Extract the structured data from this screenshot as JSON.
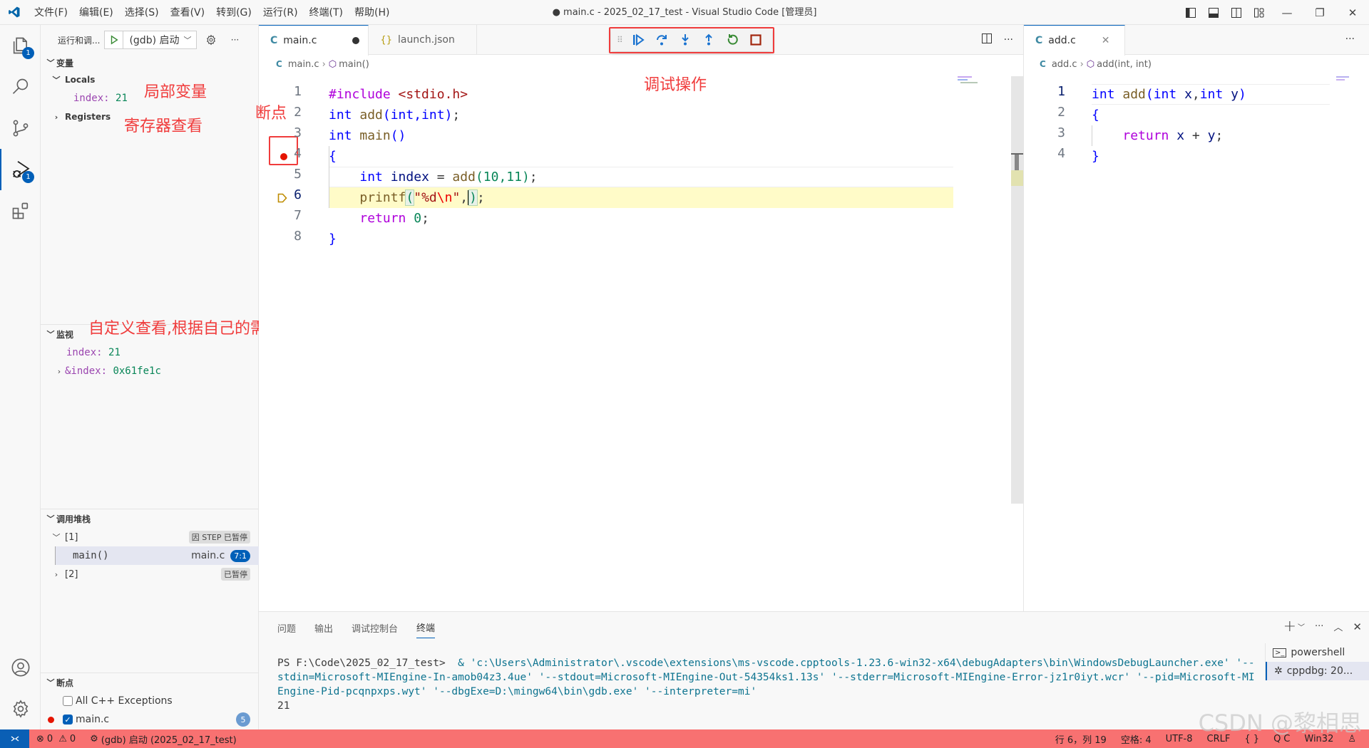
{
  "titlebar": {
    "menus": [
      "文件(F)",
      "编辑(E)",
      "选择(S)",
      "查看(V)",
      "转到(G)",
      "运行(R)",
      "终端(T)",
      "帮助(H)"
    ],
    "window_title": "● main.c - 2025_02_17_test - Visual Studio Code [管理员]",
    "minimize": "—",
    "restore": "❐",
    "close": "✕"
  },
  "activitybar": {
    "explorer_badge": "1",
    "debug_badge": "1"
  },
  "sidebar": {
    "title": "运行和调...",
    "launch_config": "(gdb) 启动",
    "variables": {
      "header": "变量",
      "locals_label": "Locals",
      "locals": [
        {
          "name": "index",
          "value": "21"
        }
      ],
      "registers_label": "Registers"
    },
    "watch": {
      "header": "监视",
      "items": [
        {
          "name": "index",
          "value": "21",
          "expandable": false
        },
        {
          "name": "&index",
          "value": "0x61fe1c",
          "expandable": true
        }
      ]
    },
    "callstack": {
      "header": "调用堆栈",
      "threads": [
        {
          "label": "[1]",
          "status": "因 STEP 已暂停",
          "expanded": true
        },
        {
          "label": "[2]",
          "status": "已暂停",
          "expanded": false
        }
      ],
      "frame": {
        "name": "main()",
        "file": "main.c",
        "pos": "7:1"
      }
    },
    "breakpoints": {
      "header": "断点",
      "items": [
        {
          "label": "All C++ Exceptions",
          "checked": false
        },
        {
          "label": "main.c",
          "checked": true,
          "line": "5"
        }
      ]
    }
  },
  "annotations": {
    "locals": "局部变量",
    "registers": "寄存器查看",
    "breakpoint": "断点",
    "debug_ops": "调试操作",
    "watch": "自定义查看,根据自己的需求查看"
  },
  "editor_main": {
    "tabs": [
      {
        "label": "main.c",
        "icon": "C",
        "active": true,
        "dirty": true
      },
      {
        "label": "launch.json",
        "icon": "{}",
        "active": false
      }
    ],
    "breadcrumb": [
      "main.c",
      "main()"
    ],
    "lines": [
      "1",
      "2",
      "3",
      "4",
      "5",
      "6",
      "7",
      "8"
    ],
    "breakpoint_line": 5,
    "current_line": 7,
    "cursor_line": 6
  },
  "editor_right": {
    "tabs": [
      {
        "label": "add.c",
        "icon": "C",
        "active": true
      }
    ],
    "breadcrumb": [
      "add.c",
      "add(int, int)"
    ],
    "lines": [
      "1",
      "2",
      "3",
      "4"
    ]
  },
  "panel": {
    "tabs": [
      "问题",
      "输出",
      "调试控制台",
      "终端"
    ],
    "active_tab": "终端",
    "terminal": {
      "prompt": "PS F:\\Code\\2025_02_17_test> ",
      "command": " & 'c:\\Users\\Administrator\\.vscode\\extensions\\ms-vscode.cpptools-1.23.6-win32-x64\\debugAdapters\\bin\\WindowsDebugLauncher.exe' '--stdin=Microsoft-MIEngine-In-amob04z3.4ue' '--stdout=Microsoft-MIEngine-Out-54354ks1.13s' '--stderr=Microsoft-MIEngine-Error-jz1r0iyt.wcr' '--pid=Microsoft-MIEngine-Pid-pcqnpxps.wyt' '--dbgExe=D:\\mingw64\\bin\\gdb.exe' '--interpreter=mi'",
      "output": "21"
    },
    "terminals": [
      {
        "label": "powershell",
        "active": false
      },
      {
        "label": "cppdbg: 20...",
        "active": true
      }
    ]
  },
  "statusbar": {
    "errors": "0",
    "warnings": "0",
    "debug_session": "(gdb) 启动 (2025_02_17_test)",
    "position": "行 6，列 19",
    "indent": "空格: 4",
    "encoding": "UTF-8",
    "eol": "CRLF",
    "language": "C",
    "platform": "Win32"
  },
  "watermark": "CSDN @黎相思",
  "colors": {
    "accent": "#005fb8",
    "statusbar_debug": "#f87171",
    "annotation": "#f03c3c",
    "current_line_highlight": "#fffbc8",
    "breakpoint": "#e51400"
  }
}
